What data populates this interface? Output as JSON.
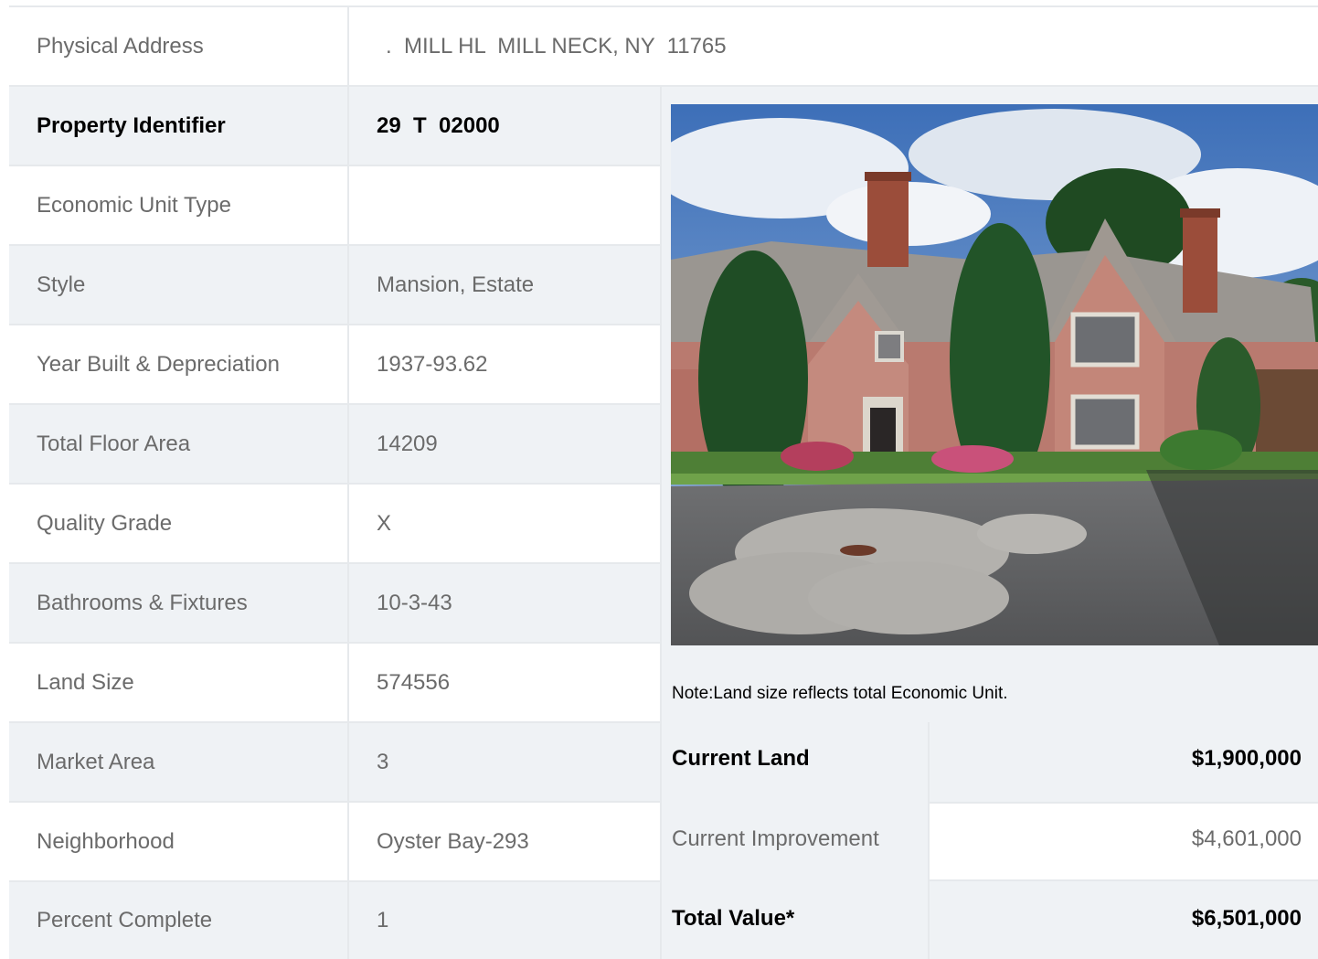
{
  "address": {
    "label": "Physical Address",
    "value": ".  MILL HL  MILL NECK, NY  11765"
  },
  "rows": [
    {
      "label": "Property Identifier",
      "value": "29  T  02000",
      "bold": true
    },
    {
      "label": "Economic Unit Type",
      "value": ""
    },
    {
      "label": "Style",
      "value": "Mansion, Estate"
    },
    {
      "label": "Year Built & Depreciation",
      "value": "1937-93.62"
    },
    {
      "label": "Total Floor Area",
      "value": "14209"
    },
    {
      "label": "Quality Grade",
      "value": "X"
    },
    {
      "label": "Bathrooms & Fixtures",
      "value": "10-3-43"
    },
    {
      "label": "Land Size",
      "value": "574556"
    },
    {
      "label": "Market Area",
      "value": "3"
    },
    {
      "label": "Neighborhood",
      "value": "Oyster Bay-293"
    },
    {
      "label": "Percent Complete",
      "value": "1"
    }
  ],
  "note": "Note:Land size reflects total Economic Unit.",
  "valuation": {
    "land_label": "Current Land",
    "land_value": "$1,900,000",
    "improvement_label": "Current Improvement",
    "improvement_value": "$4,601,000",
    "total_label": "Total Value*",
    "total_value": "$6,501,000"
  },
  "colors": {
    "shade": "#eff2f5",
    "border": "#e6e9ec",
    "text": "#6b6b6b",
    "bold_text": "#000000"
  }
}
